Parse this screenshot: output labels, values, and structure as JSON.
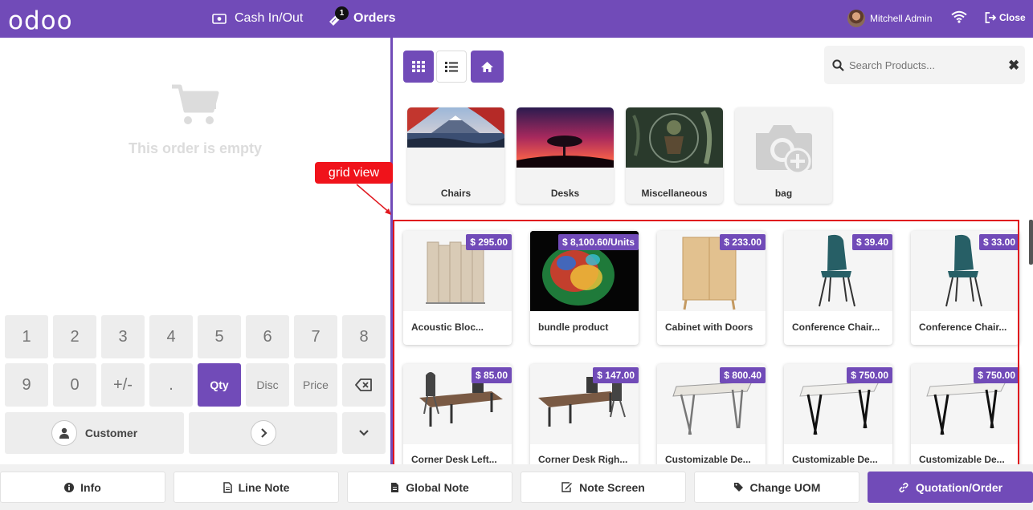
{
  "header": {
    "logo": "odoo",
    "cash_label": "Cash In/Out",
    "orders_label": "Orders",
    "orders_badge": "1",
    "user_name": "Mitchell Admin",
    "close_label": "Close"
  },
  "order": {
    "empty_text": "This order is empty"
  },
  "numpad": {
    "keys": [
      "1",
      "2",
      "3",
      "4",
      "5",
      "6",
      "7",
      "8",
      "9",
      "0",
      "+/-",
      ".",
      "Qty",
      "Disc",
      "Price"
    ],
    "active": "Qty",
    "customer_label": "Customer"
  },
  "products_toolbar": {
    "search_placeholder": "Search Products...",
    "clear_icon": "✖"
  },
  "categories": [
    {
      "label": "Chairs",
      "image": "mountain-lake-image"
    },
    {
      "label": "Desks",
      "image": "sunset-tree-image"
    },
    {
      "label": "Miscellaneous",
      "image": "robot-plant-image"
    },
    {
      "label": "bag",
      "image": "add-photo-placeholder-icon"
    }
  ],
  "products": [
    {
      "name": "Acoustic Bloc...",
      "price": "$ 295.00"
    },
    {
      "name": "bundle product",
      "price": "$ 8,100.60/Units"
    },
    {
      "name": "Cabinet with Doors",
      "price": "$ 233.00"
    },
    {
      "name": "Conference Chair...",
      "price": "$ 39.40"
    },
    {
      "name": "Conference Chair...",
      "price": "$ 33.00"
    },
    {
      "name": "Corner Desk Left...",
      "price": "$ 85.00"
    },
    {
      "name": "Corner Desk Righ...",
      "price": "$ 147.00"
    },
    {
      "name": "Customizable De...",
      "price": "$ 800.40"
    },
    {
      "name": "Customizable De...",
      "price": "$ 750.00"
    },
    {
      "name": "Customizable De...",
      "price": "$ 750.00"
    }
  ],
  "annotation": {
    "label": "grid view",
    "color": "#f0131b"
  },
  "bottom_bar": {
    "info": "Info",
    "line_note": "Line Note",
    "global_note": "Global Note",
    "note_screen": "Note Screen",
    "change_uom": "Change UOM",
    "quotation": "Quotation/Order"
  },
  "colors": {
    "brand": "#714bb8",
    "highlight": "#e0171e"
  }
}
